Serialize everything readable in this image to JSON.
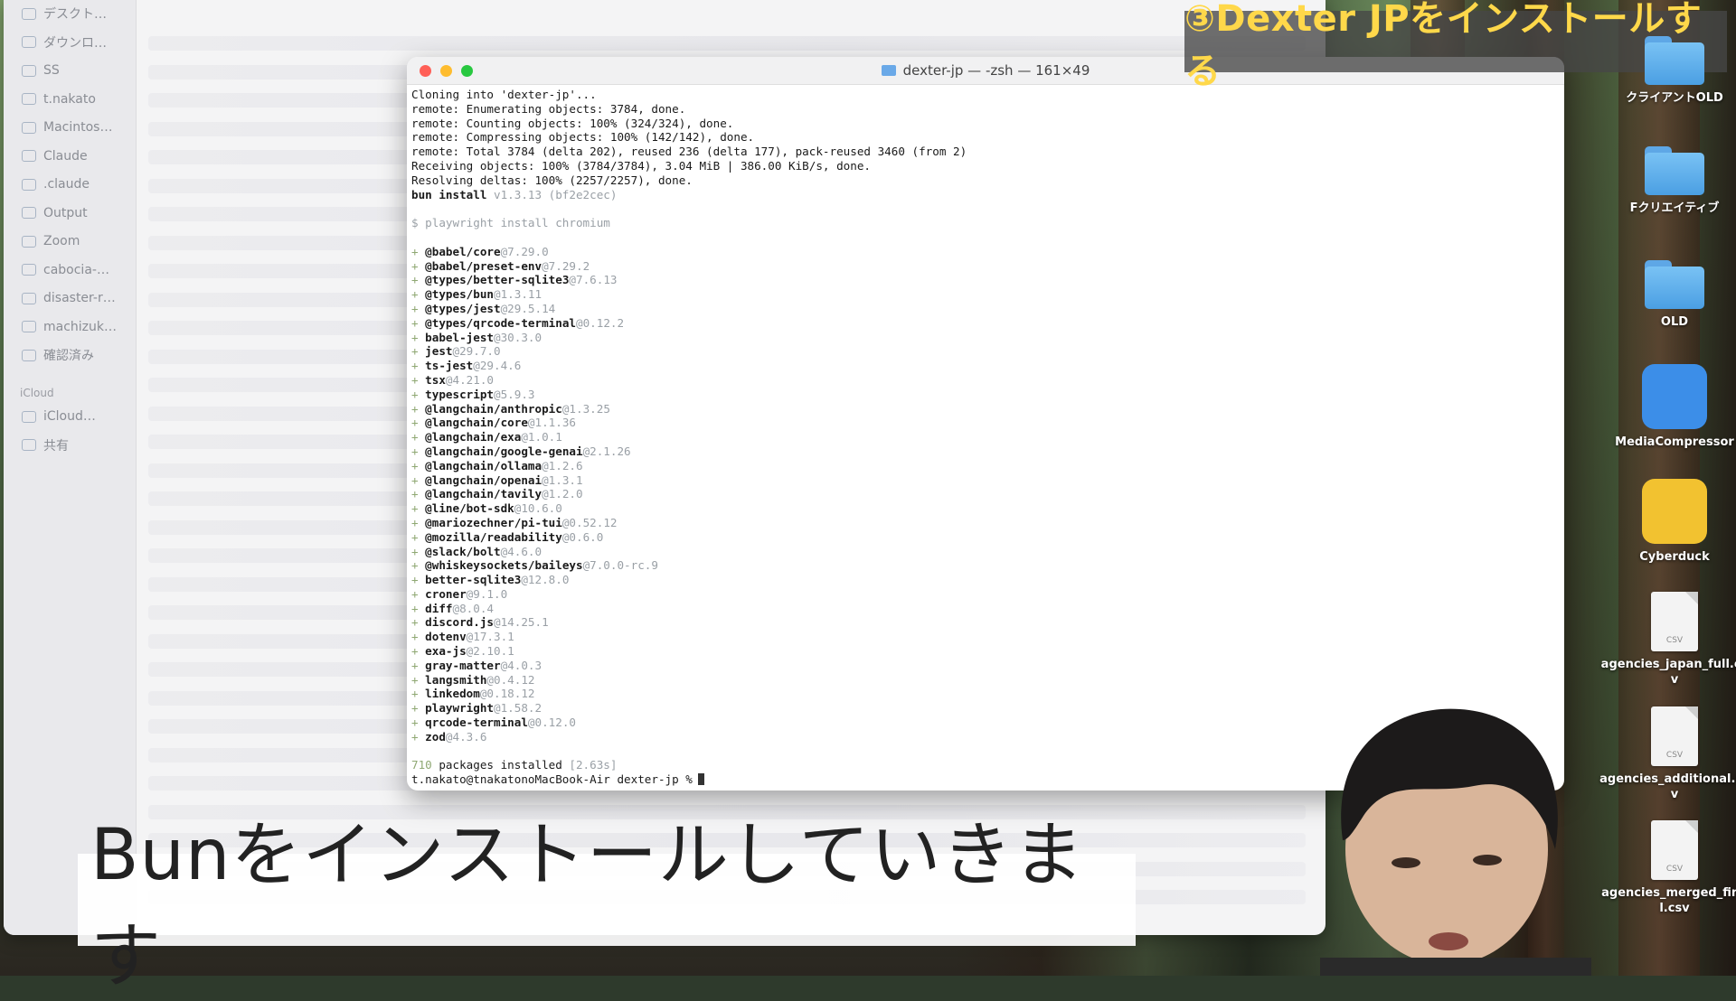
{
  "overlay": {
    "title_badge": "③Dexter JPをインストールする",
    "subtitle": "Bunをインストールしていきます"
  },
  "finder": {
    "sidebar": [
      {
        "label": "デスクト…",
        "icon": "desktop-icon"
      },
      {
        "label": "ダウンロ…",
        "icon": "download-icon"
      },
      {
        "label": "SS",
        "icon": "folder-icon"
      },
      {
        "label": "t.nakato",
        "icon": "home-icon"
      },
      {
        "label": "Macintos…",
        "icon": "disk-icon"
      },
      {
        "label": "Claude",
        "icon": "folder-icon"
      },
      {
        "label": ".claude",
        "icon": "folder-icon"
      },
      {
        "label": "Output",
        "icon": "folder-icon"
      },
      {
        "label": "Zoom",
        "icon": "folder-icon"
      },
      {
        "label": "cabocia-…",
        "icon": "folder-icon"
      },
      {
        "label": "disaster-r…",
        "icon": "folder-icon"
      },
      {
        "label": "machizuk…",
        "icon": "folder-icon"
      },
      {
        "label": "確認済み",
        "icon": "folder-icon"
      }
    ],
    "icloud_section": "iCloud",
    "icloud_items": [
      {
        "label": "iCloud…",
        "icon": "cloud-icon"
      },
      {
        "label": "共有",
        "icon": "shared-folder-icon"
      }
    ]
  },
  "terminal": {
    "title": "dexter-jp — -zsh — 161×49",
    "colors": {
      "close": "#ff5f57",
      "minimize": "#febc2e",
      "zoom": "#28c840"
    },
    "lines": [
      {
        "text": "Cloning into 'dexter-jp'..."
      },
      {
        "text": "remote: Enumerating objects: 3784, done."
      },
      {
        "text": "remote: Counting objects: 100% (324/324), done."
      },
      {
        "text": "remote: Compressing objects: 100% (142/142), done."
      },
      {
        "text": "remote: Total 3784 (delta 202), reused 236 (delta 177), pack-reused 3460 (from 2)"
      },
      {
        "text": "Receiving objects: 100% (3784/3784), 3.04 MiB | 386.00 KiB/s, done."
      },
      {
        "text": "Resolving deltas: 100% (2257/2257), done."
      },
      {
        "cmd": "bun install",
        "ver": " v1.3.13 (bf2e2cec)"
      },
      {
        "text": ""
      },
      {
        "dim": "$ playwright install chromium"
      },
      {
        "text": ""
      }
    ],
    "packages": [
      {
        "name": "@babel/core",
        "ver": "@7.29.0"
      },
      {
        "name": "@babel/preset-env",
        "ver": "@7.29.2"
      },
      {
        "name": "@types/better-sqlite3",
        "ver": "@7.6.13"
      },
      {
        "name": "@types/bun",
        "ver": "@1.3.11"
      },
      {
        "name": "@types/jest",
        "ver": "@29.5.14"
      },
      {
        "name": "@types/qrcode-terminal",
        "ver": "@0.12.2"
      },
      {
        "name": "babel-jest",
        "ver": "@30.3.0"
      },
      {
        "name": "jest",
        "ver": "@29.7.0"
      },
      {
        "name": "ts-jest",
        "ver": "@29.4.6"
      },
      {
        "name": "tsx",
        "ver": "@4.21.0"
      },
      {
        "name": "typescript",
        "ver": "@5.9.3"
      },
      {
        "name": "@langchain/anthropic",
        "ver": "@1.3.25"
      },
      {
        "name": "@langchain/core",
        "ver": "@1.1.36"
      },
      {
        "name": "@langchain/exa",
        "ver": "@1.0.1"
      },
      {
        "name": "@langchain/google-genai",
        "ver": "@2.1.26"
      },
      {
        "name": "@langchain/ollama",
        "ver": "@1.2.6"
      },
      {
        "name": "@langchain/openai",
        "ver": "@1.3.1"
      },
      {
        "name": "@langchain/tavily",
        "ver": "@1.2.0"
      },
      {
        "name": "@line/bot-sdk",
        "ver": "@10.6.0"
      },
      {
        "name": "@mariozechner/pi-tui",
        "ver": "@0.52.12"
      },
      {
        "name": "@mozilla/readability",
        "ver": "@0.6.0"
      },
      {
        "name": "@slack/bolt",
        "ver": "@4.6.0"
      },
      {
        "name": "@whiskeysockets/baileys",
        "ver": "@7.0.0-rc.9"
      },
      {
        "name": "better-sqlite3",
        "ver": "@12.8.0"
      },
      {
        "name": "croner",
        "ver": "@9.1.0"
      },
      {
        "name": "diff",
        "ver": "@8.0.4"
      },
      {
        "name": "discord.js",
        "ver": "@14.25.1"
      },
      {
        "name": "dotenv",
        "ver": "@17.3.1"
      },
      {
        "name": "exa-js",
        "ver": "@2.10.1"
      },
      {
        "name": "gray-matter",
        "ver": "@4.0.3"
      },
      {
        "name": "langsmith",
        "ver": "@0.4.12"
      },
      {
        "name": "linkedom",
        "ver": "@0.18.12"
      },
      {
        "name": "playwright",
        "ver": "@1.58.2"
      },
      {
        "name": "qrcode-terminal",
        "ver": "@0.12.0"
      },
      {
        "name": "zod",
        "ver": "@4.3.6"
      }
    ],
    "summary_count": "710",
    "summary_text": " packages installed",
    "summary_time": " [2.63s]",
    "prompt": "t.nakato@tnakatonoMacBook-Air dexter-jp %"
  },
  "desktop_icons": [
    {
      "label": "クライアントOLD",
      "kind": "folder"
    },
    {
      "label": "Fクリエイティブ",
      "kind": "folder"
    },
    {
      "label": "OLD",
      "kind": "folder"
    },
    {
      "label": "MediaCompressor",
      "kind": "app",
      "color": "#3c8ee8"
    },
    {
      "label": "Cyberduck",
      "kind": "app",
      "color": "#f2c230"
    },
    {
      "label": "agencies_japan_full.csv",
      "kind": "csv"
    },
    {
      "label": "agencies_additional.csv",
      "kind": "csv"
    },
    {
      "label": "agencies_merged_final.csv",
      "kind": "csv"
    }
  ]
}
